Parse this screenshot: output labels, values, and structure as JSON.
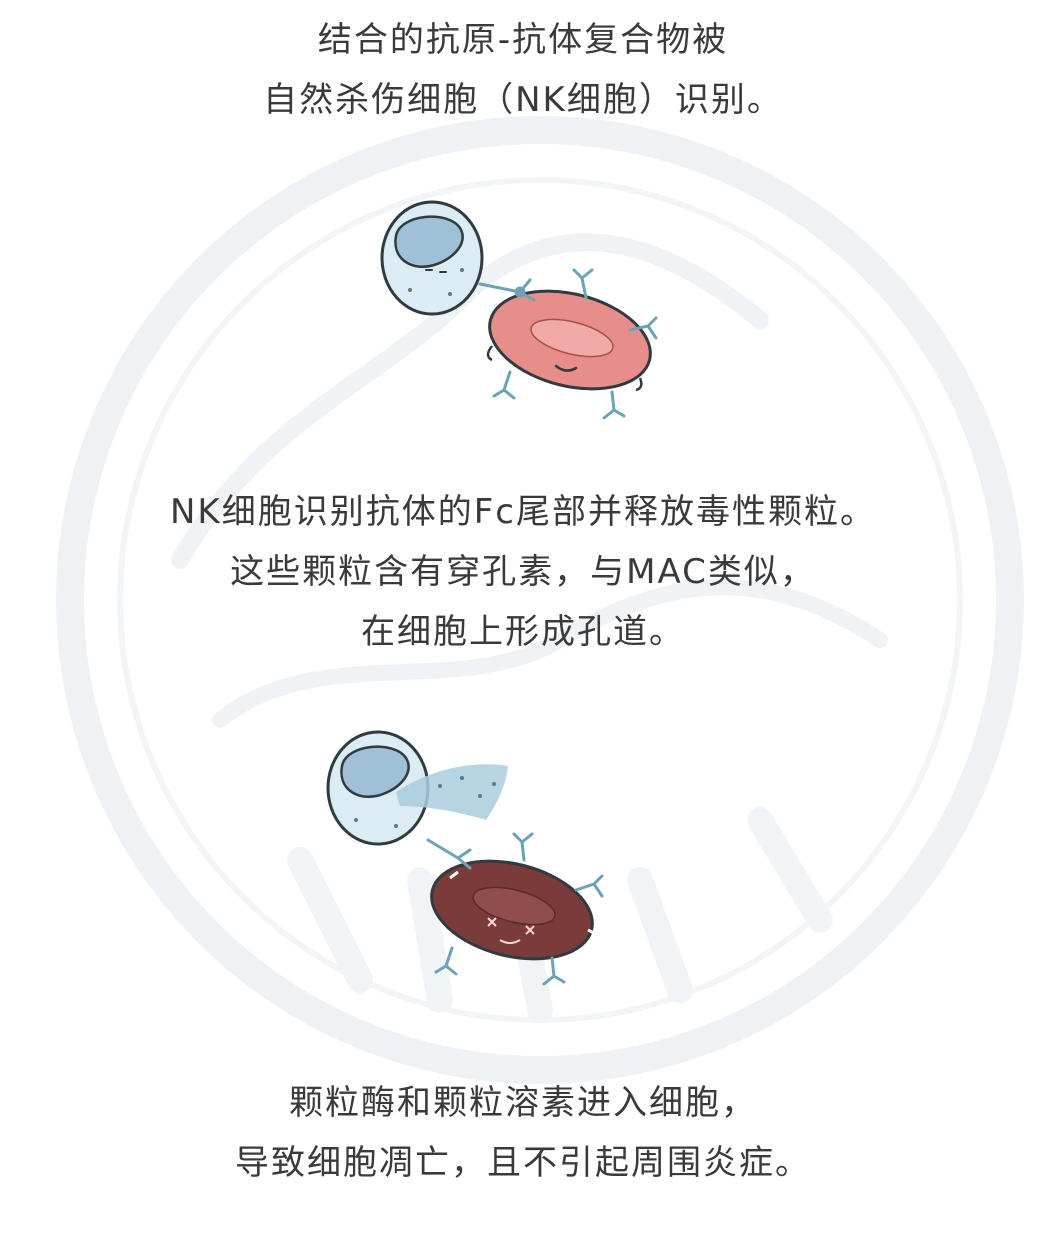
{
  "captions": [
    {
      "lines": [
        "结合的抗原-抗体复合物被",
        "自然杀伤细胞（NK细胞）识别。"
      ]
    },
    {
      "lines": [
        "NK细胞识别抗体的Fc尾部并释放毒性颗粒。",
        "这些颗粒含有穿孔素，与MAC类似，",
        "在细胞上形成孔道。"
      ]
    },
    {
      "lines": [
        "颗粒酶和颗粒溶素进入细胞，",
        "导致细胞凋亡，且不引起周围炎症。"
      ]
    }
  ],
  "colors": {
    "text": "#3a3a3a",
    "nk_cell_fill": "#dcecf4",
    "nk_nucleus": "#9fc0d6",
    "outline": "#2f3b40",
    "target_cell_healthy": "#e88e8a",
    "target_cell_dead": "#7a3b3b",
    "antibody": "#6aa3b5",
    "granule_spray": "#a9cddd",
    "watermark": "#eef2f4"
  },
  "icons": {
    "nk_cell": "nk-cell-icon",
    "target_cell": "red-blood-cell-icon",
    "antibody": "antibody-y-icon",
    "granules": "toxic-granule-spray-icon",
    "watermark": "circular-stamp-watermark"
  }
}
